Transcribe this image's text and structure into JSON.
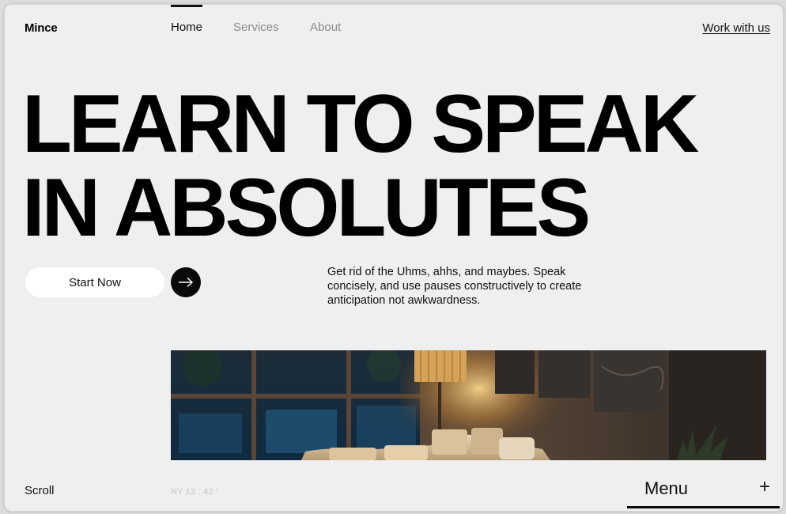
{
  "header": {
    "logo": "Mince",
    "nav": [
      {
        "label": "Home",
        "active": true
      },
      {
        "label": "Services",
        "active": false
      },
      {
        "label": "About",
        "active": false
      }
    ],
    "cta": "Work with us"
  },
  "hero": {
    "headline_line1": "LEARN TO SPEAK",
    "headline_line2": "IN ABSOLUTES",
    "start_button": "Start Now",
    "arrow_icon": "arrow-right-icon",
    "description": "Get rid of the Uhms, ahhs, and maybes. Speak concisely, and use pauses constructively to create anticipation not awkwardness."
  },
  "footer": {
    "scroll_label": "Scroll",
    "clock": "NY 13 : 42 '",
    "menu_label": "Menu",
    "menu_icon": "plus-icon"
  },
  "colors": {
    "background": "#efefef",
    "text": "#000000",
    "muted_nav": "#8c8c8c",
    "button_bg": "#ffffff",
    "arrow_bg": "#0a0a0a"
  }
}
